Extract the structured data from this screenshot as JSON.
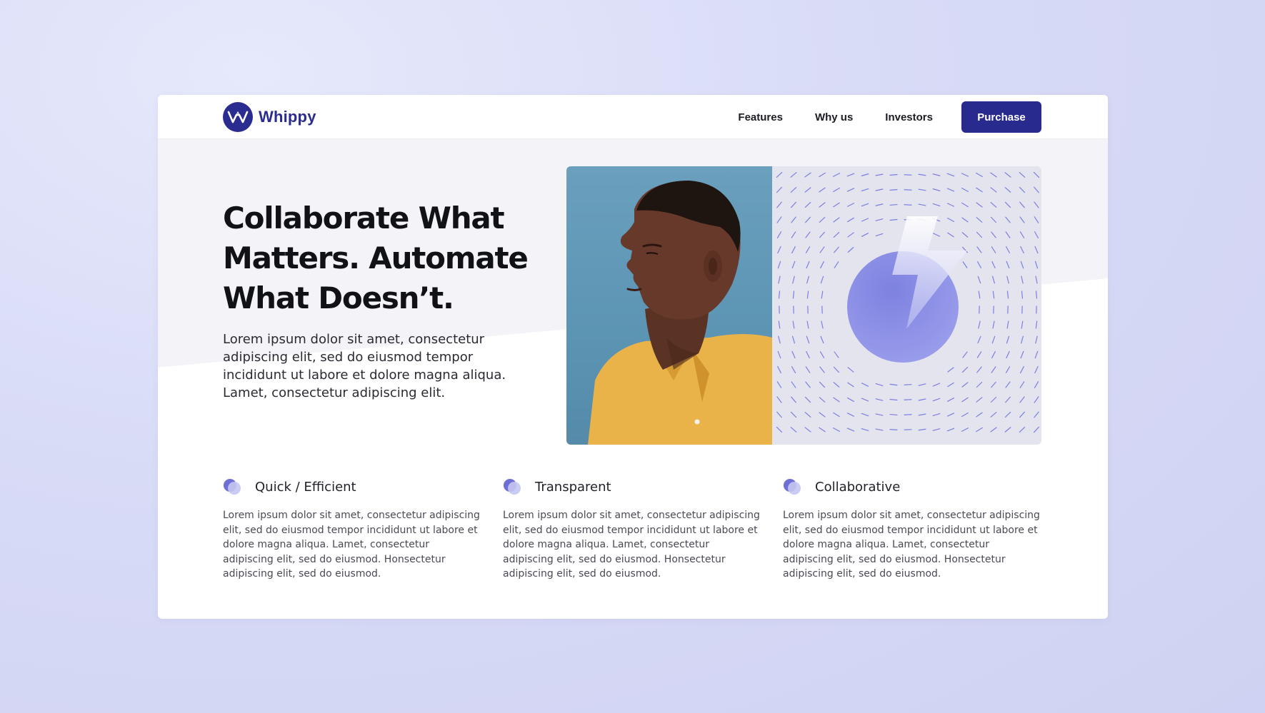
{
  "brand": {
    "name": "Whippy",
    "accent": "#2b2c8f",
    "light_accent": "#7b7fe0"
  },
  "nav": {
    "items": [
      {
        "label": "Features"
      },
      {
        "label": "Why us"
      },
      {
        "label": "Investors"
      }
    ],
    "cta_label": "Purchase"
  },
  "hero": {
    "title": "Collaborate What Matters. Automate What Doesn’t.",
    "body": "Lorem ipsum dolor sit amet, consectetur adipiscing elit, sed do eiusmod tempor incididunt ut labore et dolore magna aliqua. Lamet, consectetur adipiscing elit.",
    "photo_icon": "portrait-photo",
    "illustration_icon": "lightning-bolt-icon"
  },
  "features": [
    {
      "title": "Quick / Efficient",
      "body": "Lorem ipsum dolor sit amet, consectetur adipiscing elit, sed do eiusmod tempor incididunt ut labore et dolore magna aliqua. Lamet, consectetur adipiscing elit, sed do eiusmod. Honsectetur adipiscing elit, sed do eiusmod."
    },
    {
      "title": "Transparent",
      "body": "Lorem ipsum dolor sit amet, consectetur adipiscing elit, sed do eiusmod tempor incididunt ut labore et dolore magna aliqua. Lamet, consectetur adipiscing elit, sed do eiusmod. Honsectetur adipiscing elit, sed do eiusmod."
    },
    {
      "title": "Collaborative",
      "body": "Lorem ipsum dolor sit amet, consectetur adipiscing elit, sed do eiusmod tempor incididunt ut labore et dolore magna aliqua. Lamet, consectetur adipiscing elit, sed do eiusmod. Honsectetur adipiscing elit, sed do eiusmod."
    }
  ]
}
